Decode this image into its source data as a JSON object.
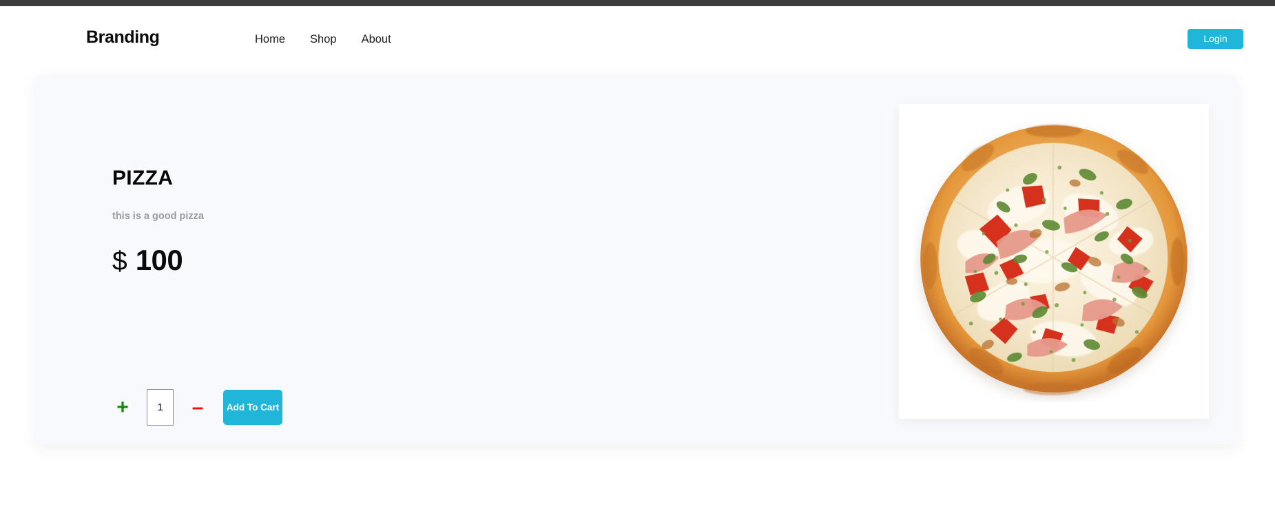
{
  "header": {
    "brand": "Branding",
    "nav": [
      {
        "label": "Home"
      },
      {
        "label": "Shop"
      },
      {
        "label": "About"
      }
    ],
    "login_label": "Login"
  },
  "product": {
    "title": "PIZZA",
    "description": "this is a good pizza",
    "currency_symbol": "$",
    "price": "100",
    "quantity_value": "1",
    "quantity_placeholder": "1",
    "increment_label": "+",
    "decrement_label": "–",
    "add_to_cart_label": "Add To Cart",
    "image_alt": "pizza-photo"
  },
  "colors": {
    "accent": "#1fb6da",
    "topbar": "#3c3c3c",
    "card_bg": "#f8f9fc",
    "increment": "#138a0c",
    "decrement": "#f90b07",
    "text_muted": "#9b9ba3"
  }
}
